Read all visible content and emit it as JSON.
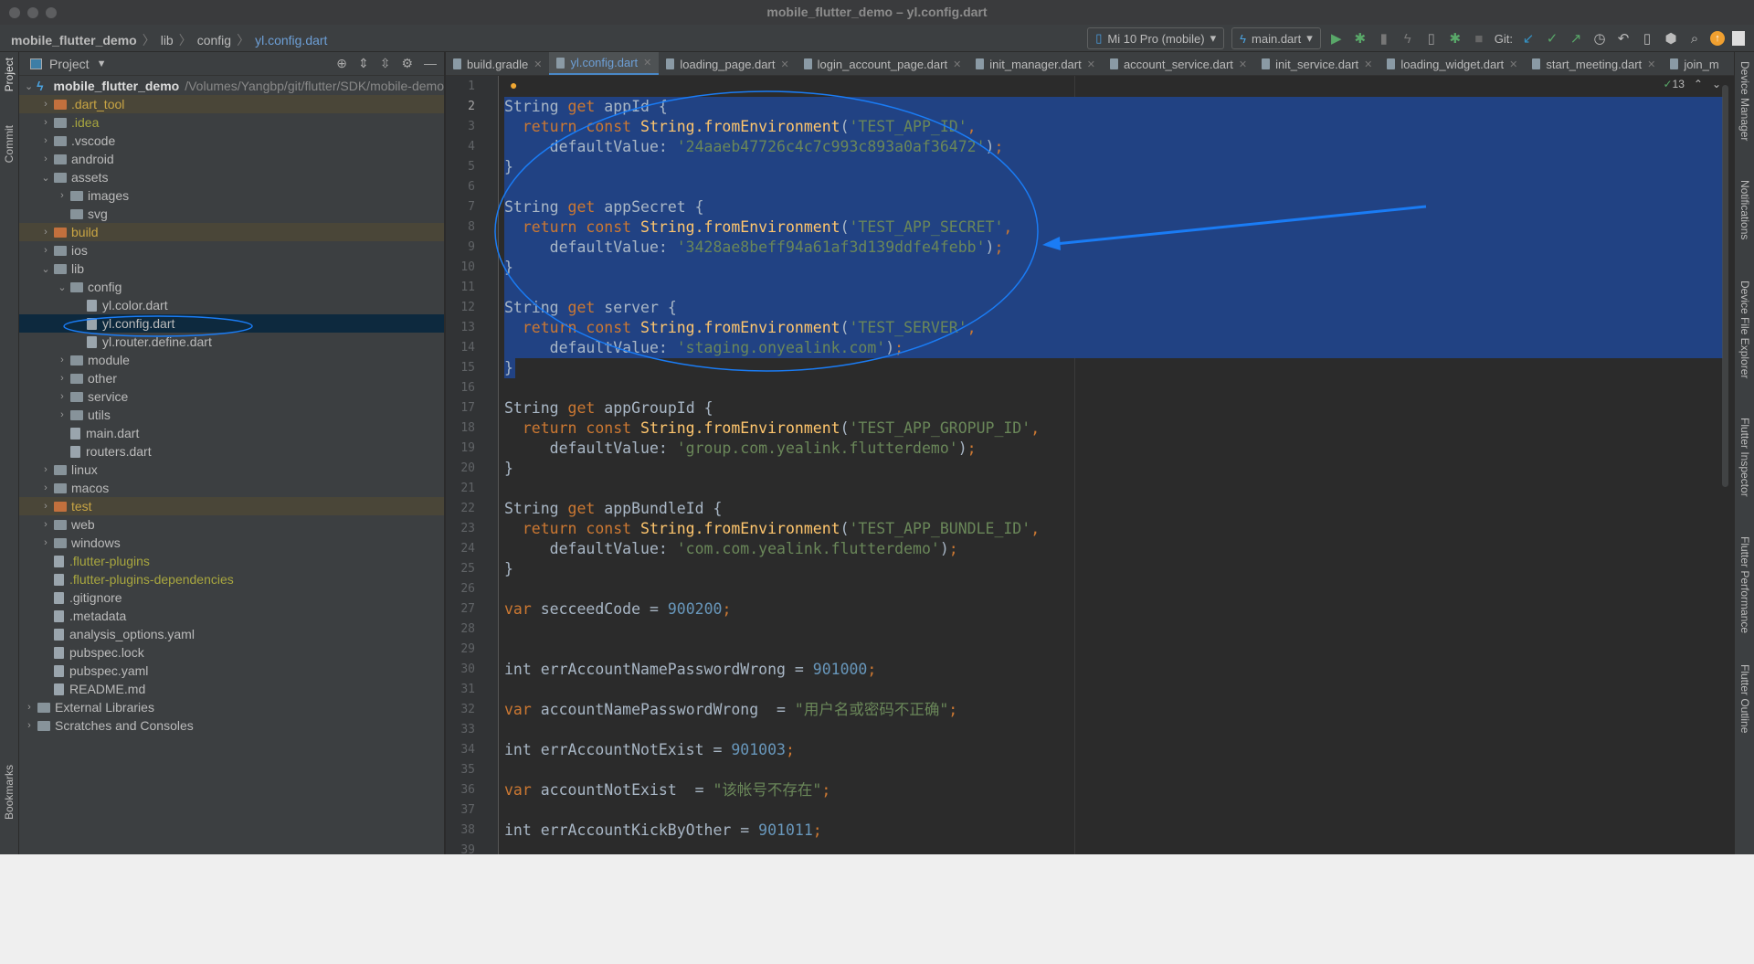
{
  "window": {
    "title": "mobile_flutter_demo – yl.config.dart"
  },
  "breadcrumb": [
    "mobile_flutter_demo",
    "lib",
    "config",
    "yl.config.dart"
  ],
  "toolbar": {
    "device": "Mi 10 Pro (mobile)",
    "run_config": "main.dart",
    "git_label": "Git:"
  },
  "left_strip": {
    "project": "Project",
    "commit": "Commit",
    "bookmarks": "Bookmarks"
  },
  "right_strip": [
    "Device Manager",
    "Notifications",
    "Device File Explorer",
    "Flutter Inspector",
    "Flutter Performance",
    "Flutter Outline"
  ],
  "project": {
    "title": "Project",
    "tree": [
      {
        "level": 0,
        "label": "mobile_flutter_demo",
        "kind": "root",
        "state": "open",
        "path": "/Volumes/Yangbp/git/flutter/SDK/mobile-demo"
      },
      {
        "level": 1,
        "label": ".dart_tool",
        "kind": "folder",
        "state": "closed",
        "style": "excluded"
      },
      {
        "level": 1,
        "label": ".idea",
        "kind": "folder",
        "state": "closed",
        "style": "ignored"
      },
      {
        "level": 1,
        "label": ".vscode",
        "kind": "folder",
        "state": "closed"
      },
      {
        "level": 1,
        "label": "android",
        "kind": "folder",
        "state": "closed"
      },
      {
        "level": 1,
        "label": "assets",
        "kind": "folder",
        "state": "open"
      },
      {
        "level": 2,
        "label": "images",
        "kind": "folder",
        "state": "closed"
      },
      {
        "level": 2,
        "label": "svg",
        "kind": "folder",
        "state": "none"
      },
      {
        "level": 1,
        "label": "build",
        "kind": "folder",
        "state": "closed",
        "style": "excluded"
      },
      {
        "level": 1,
        "label": "ios",
        "kind": "folder",
        "state": "closed"
      },
      {
        "level": 1,
        "label": "lib",
        "kind": "folder",
        "state": "open"
      },
      {
        "level": 2,
        "label": "config",
        "kind": "folder",
        "state": "open"
      },
      {
        "level": 3,
        "label": "yl.color.dart",
        "kind": "file"
      },
      {
        "level": 3,
        "label": "yl.config.dart",
        "kind": "file",
        "style": "selected"
      },
      {
        "level": 3,
        "label": "yl.router.define.dart",
        "kind": "file"
      },
      {
        "level": 2,
        "label": "module",
        "kind": "folder",
        "state": "closed"
      },
      {
        "level": 2,
        "label": "other",
        "kind": "folder",
        "state": "closed"
      },
      {
        "level": 2,
        "label": "service",
        "kind": "folder",
        "state": "closed"
      },
      {
        "level": 2,
        "label": "utils",
        "kind": "folder",
        "state": "closed"
      },
      {
        "level": 2,
        "label": "main.dart",
        "kind": "file"
      },
      {
        "level": 2,
        "label": "routers.dart",
        "kind": "file"
      },
      {
        "level": 1,
        "label": "linux",
        "kind": "folder",
        "state": "closed"
      },
      {
        "level": 1,
        "label": "macos",
        "kind": "folder",
        "state": "closed"
      },
      {
        "level": 1,
        "label": "test",
        "kind": "folder",
        "state": "closed",
        "style": "excluded"
      },
      {
        "level": 1,
        "label": "web",
        "kind": "folder",
        "state": "closed"
      },
      {
        "level": 1,
        "label": "windows",
        "kind": "folder",
        "state": "closed"
      },
      {
        "level": 1,
        "label": ".flutter-plugins",
        "kind": "file",
        "style": "ignored"
      },
      {
        "level": 1,
        "label": ".flutter-plugins-dependencies",
        "kind": "file",
        "style": "ignored"
      },
      {
        "level": 1,
        "label": ".gitignore",
        "kind": "file"
      },
      {
        "level": 1,
        "label": ".metadata",
        "kind": "file"
      },
      {
        "level": 1,
        "label": "analysis_options.yaml",
        "kind": "file"
      },
      {
        "level": 1,
        "label": "pubspec.lock",
        "kind": "file"
      },
      {
        "level": 1,
        "label": "pubspec.yaml",
        "kind": "file"
      },
      {
        "level": 1,
        "label": "README.md",
        "kind": "file"
      },
      {
        "level": 0,
        "label": "External Libraries",
        "kind": "folder",
        "state": "closed"
      },
      {
        "level": 0,
        "label": "Scratches and Consoles",
        "kind": "folder",
        "state": "closed"
      }
    ]
  },
  "tabs": [
    {
      "label": "build.gradle"
    },
    {
      "label": "yl.config.dart",
      "active": true
    },
    {
      "label": "loading_page.dart"
    },
    {
      "label": "login_account_page.dart"
    },
    {
      "label": "init_manager.dart"
    },
    {
      "label": "account_service.dart"
    },
    {
      "label": "init_service.dart"
    },
    {
      "label": "loading_widget.dart"
    },
    {
      "label": "start_meeting.dart"
    },
    {
      "label": "join_m"
    }
  ],
  "editor": {
    "inspection_count": "13",
    "current_line": 2,
    "selection": {
      "from_line": 2,
      "to_line": 15
    },
    "lines": [
      [],
      [
        [
          "p",
          "String "
        ],
        [
          "kw",
          "get"
        ],
        [
          "p",
          " appId {"
        ]
      ],
      [
        [
          "kw",
          "  return const "
        ],
        [
          "cls",
          "String.fromEnvironment"
        ],
        [
          "p",
          "("
        ],
        [
          "str",
          "'TEST_APP_ID'"
        ],
        [
          "kw",
          ","
        ]
      ],
      [
        [
          "p",
          "     defaultValue: "
        ],
        [
          "str",
          "'24aaeb47726c4c7c993c893a0af36472'"
        ],
        [
          "p",
          ")"
        ],
        [
          "kw",
          ";"
        ]
      ],
      [
        [
          "p",
          "}"
        ]
      ],
      [],
      [
        [
          "p",
          "String "
        ],
        [
          "kw",
          "get"
        ],
        [
          "p",
          " appSecret {"
        ]
      ],
      [
        [
          "kw",
          "  return const "
        ],
        [
          "cls",
          "String.fromEnvironment"
        ],
        [
          "p",
          "("
        ],
        [
          "str",
          "'TEST_APP_SECRET'"
        ],
        [
          "kw",
          ","
        ]
      ],
      [
        [
          "p",
          "     defaultValue: "
        ],
        [
          "str",
          "'3428ae8beff94a61af3d139ddfe4febb'"
        ],
        [
          "p",
          ")"
        ],
        [
          "kw",
          ";"
        ]
      ],
      [
        [
          "p",
          "}"
        ]
      ],
      [],
      [
        [
          "p",
          "String "
        ],
        [
          "kw",
          "get"
        ],
        [
          "p",
          " server {"
        ]
      ],
      [
        [
          "kw",
          "  return const "
        ],
        [
          "cls",
          "String.fromEnvironment"
        ],
        [
          "p",
          "("
        ],
        [
          "str",
          "'TEST_SERVER'"
        ],
        [
          "kw",
          ","
        ]
      ],
      [
        [
          "p",
          "     defaultValue: "
        ],
        [
          "str",
          "'staging.onyealink.com'"
        ],
        [
          "p",
          ")"
        ],
        [
          "kw",
          ";"
        ]
      ],
      [
        [
          "p",
          "}"
        ]
      ],
      [],
      [
        [
          "p",
          "String "
        ],
        [
          "kw",
          "get"
        ],
        [
          "p",
          " appGroupId {"
        ]
      ],
      [
        [
          "kw",
          "  return const "
        ],
        [
          "cls",
          "String.fromEnvironment"
        ],
        [
          "p",
          "("
        ],
        [
          "str",
          "'TEST_APP_GROPUP_ID'"
        ],
        [
          "kw",
          ","
        ]
      ],
      [
        [
          "p",
          "     defaultValue: "
        ],
        [
          "str",
          "'group.com.yealink.flutterdemo'"
        ],
        [
          "p",
          ")"
        ],
        [
          "kw",
          ";"
        ]
      ],
      [
        [
          "p",
          "}"
        ]
      ],
      [],
      [
        [
          "p",
          "String "
        ],
        [
          "kw",
          "get"
        ],
        [
          "p",
          " appBundleId {"
        ]
      ],
      [
        [
          "kw",
          "  return const "
        ],
        [
          "cls",
          "String.fromEnvironment"
        ],
        [
          "p",
          "("
        ],
        [
          "str",
          "'TEST_APP_BUNDLE_ID'"
        ],
        [
          "kw",
          ","
        ]
      ],
      [
        [
          "p",
          "     defaultValue: "
        ],
        [
          "str",
          "'com.com.yealink.flutterdemo'"
        ],
        [
          "p",
          ")"
        ],
        [
          "kw",
          ";"
        ]
      ],
      [
        [
          "p",
          "}"
        ]
      ],
      [],
      [
        [
          "kw",
          "var "
        ],
        [
          "p",
          "secceedCode = "
        ],
        [
          "num",
          "900200"
        ],
        [
          "kw",
          ";"
        ]
      ],
      [],
      [],
      [
        [
          "p",
          "int errAccountNamePasswordWrong = "
        ],
        [
          "num",
          "901000"
        ],
        [
          "kw",
          ";"
        ]
      ],
      [],
      [
        [
          "kw",
          "var "
        ],
        [
          "p",
          "accountNamePasswordWrong  = "
        ],
        [
          "str",
          "\"用户名或密码不正确\""
        ],
        [
          "kw",
          ";"
        ]
      ],
      [],
      [
        [
          "p",
          "int errAccountNotExist = "
        ],
        [
          "num",
          "901003"
        ],
        [
          "kw",
          ";"
        ]
      ],
      [],
      [
        [
          "kw",
          "var "
        ],
        [
          "p",
          "accountNotExist  = "
        ],
        [
          "str",
          "\"该帐号不存在\""
        ],
        [
          "kw",
          ";"
        ]
      ],
      [],
      [
        [
          "p",
          "int errAccountKickByOther = "
        ],
        [
          "num",
          "901011"
        ],
        [
          "kw",
          ";"
        ]
      ],
      []
    ]
  },
  "colors": {
    "annotation": "#1a7cf5",
    "selection": "#214283",
    "keyword": "#cc7832",
    "string": "#6a8759",
    "number": "#6897bb"
  }
}
